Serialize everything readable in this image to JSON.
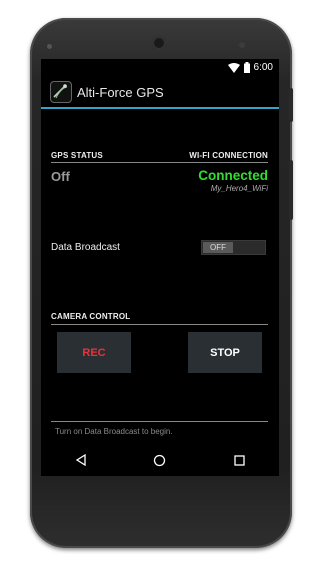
{
  "status_bar": {
    "time": "6:00",
    "icons": [
      "wifi-icon",
      "battery-icon"
    ]
  },
  "action_bar": {
    "title": "Alti-Force GPS",
    "icon": "app-logo-icon",
    "accent_color": "#33a5c9"
  },
  "gps": {
    "header": "GPS STATUS",
    "value": "Off"
  },
  "wifi": {
    "header": "WI-FI CONNECTION",
    "value": "Connected",
    "ssid": "My_Hero4_WiFi",
    "status_color": "#33dd33"
  },
  "broadcast": {
    "label": "Data Broadcast",
    "toggle_state": "OFF"
  },
  "camera": {
    "header": "CAMERA CONTROL",
    "rec_label": "REC",
    "stop_label": "STOP",
    "rec_color": "#e8333a"
  },
  "footer": {
    "hint": "Turn on Data Broadcast to begin."
  },
  "nav": {
    "back": "back-icon",
    "home": "home-icon",
    "recents": "recents-icon"
  }
}
